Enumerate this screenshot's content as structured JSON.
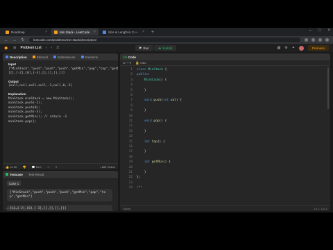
{
  "browser": {
    "tabs": [
      {
        "label": "Roadmap",
        "active": false
      },
      {
        "label": "Min Stack - LeetCode",
        "active": true
      },
      {
        "label": "Size & Length in C++",
        "active": false
      }
    ],
    "url": "leetcode.com/problems/min-stack/description/"
  },
  "nav": {
    "problem_list": "Problem List",
    "run": "Run",
    "submit": "Submit",
    "premium": "Premium"
  },
  "description": {
    "tabs": [
      "Description",
      "Editorial",
      "Submissions",
      "Solutions"
    ],
    "input_label": "Input",
    "input_text": "[\"MinStack\",\"push\",\"push\",\"push\",\"getMin\",\"pop\",\"top\",\"getMin\"]\n[[],[-2],[0],[-3],[],[],[],[]]",
    "output_label": "Output",
    "output_text": "[null,null,null,null,-3,null,0,-2]",
    "explanation_label": "Explanation",
    "explanation_text": "MinStack minStack = new MinStack();\nminStack.push(-2);\nminStack.push(0);\nminStack.push(-3);\nminStack.getMin(); // return -3\nminStack.pop();",
    "likes": "14.2K",
    "comments": "16.K",
    "online": "• 885 Online"
  },
  "testcase": {
    "tabs": [
      "Testcase",
      "Test Result"
    ],
    "case_label": "Case 1",
    "input1": "[\"MinStack\",\"push\",\"push\",\"push\",\"getMin\",\"pop\",\"top\",\"getMin\"]",
    "input2": "[[],[-2],[0],[-3],[],[],[],[]]",
    "source": "Source"
  },
  "code": {
    "tab": "Code",
    "lang": "C++",
    "mode": "Auto",
    "lines": [
      {
        "n": "1",
        "t": "class MinStack {"
      },
      {
        "n": "2",
        "t": "public:"
      },
      {
        "n": "3",
        "t": "    MinStack() {"
      },
      {
        "n": "4",
        "t": ""
      },
      {
        "n": "5",
        "t": "    }"
      },
      {
        "n": "6",
        "t": ""
      },
      {
        "n": "7",
        "t": "    void push(int val) {"
      },
      {
        "n": "8",
        "t": ""
      },
      {
        "n": "9",
        "t": "    }"
      },
      {
        "n": "10",
        "t": ""
      },
      {
        "n": "11",
        "t": "    void pop() {"
      },
      {
        "n": "12",
        "t": ""
      },
      {
        "n": "13",
        "t": "    }"
      },
      {
        "n": "14",
        "t": ""
      },
      {
        "n": "15",
        "t": "    int top() {"
      },
      {
        "n": "16",
        "t": ""
      },
      {
        "n": "17",
        "t": "    }"
      },
      {
        "n": "18",
        "t": ""
      },
      {
        "n": "19",
        "t": "    int getMin() {"
      },
      {
        "n": "20",
        "t": ""
      },
      {
        "n": "21",
        "t": "    }"
      },
      {
        "n": "22",
        "t": "};"
      },
      {
        "n": "23",
        "t": ""
      },
      {
        "n": "24",
        "t": "/**"
      }
    ],
    "saved": "Saved",
    "cursor_pos": "Ln 1, Col 1"
  },
  "colors": {
    "accent": "#ffa116",
    "success": "#2cbb5d",
    "keyword": "#569cd6"
  }
}
